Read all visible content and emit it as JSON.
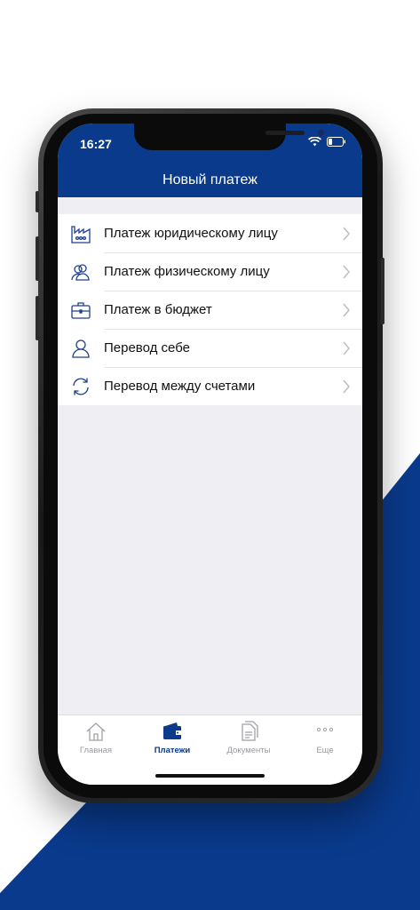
{
  "status_bar": {
    "time": "16:27"
  },
  "header": {
    "title": "Новый платеж"
  },
  "menu": {
    "items": [
      {
        "label": "Платеж юридическому лицу",
        "icon": "factory-icon"
      },
      {
        "label": "Платеж физическому лицу",
        "icon": "users-icon"
      },
      {
        "label": "Платеж в бюджет",
        "icon": "briefcase-icon"
      },
      {
        "label": "Перевод себе",
        "icon": "user-icon"
      },
      {
        "label": "Перевод между счетами",
        "icon": "refresh-icon"
      }
    ]
  },
  "tabbar": {
    "tabs": [
      {
        "label": "Главная",
        "icon": "home-icon"
      },
      {
        "label": "Платежи",
        "icon": "wallet-icon",
        "active": true
      },
      {
        "label": "Документы",
        "icon": "documents-icon"
      },
      {
        "label": "Еще",
        "icon": "more-icon"
      }
    ]
  },
  "colors": {
    "brand": "#0a3a8c",
    "background": "#eeeef3",
    "icon": "#1f3f8f"
  }
}
